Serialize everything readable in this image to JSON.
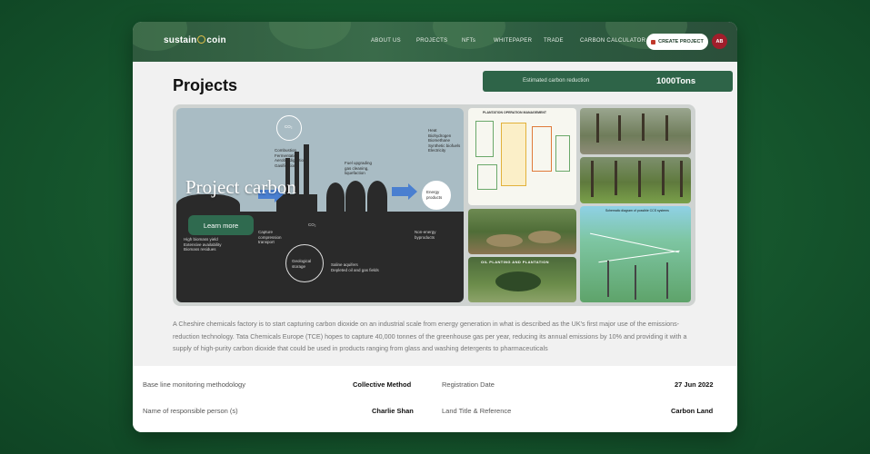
{
  "app": {
    "logo_left": "sustain",
    "logo_right": "coin"
  },
  "nav": {
    "items": [
      {
        "label": "ABOUT US"
      },
      {
        "label": "PROJECTS"
      },
      {
        "label": "NFTs"
      },
      {
        "label": "WHITEPAPER"
      },
      {
        "label": "TRADE"
      },
      {
        "label": "CARBON CALCULATOR"
      }
    ],
    "create_label": "CREATE PROJECT",
    "avatar_initials": "AB"
  },
  "page": {
    "title": "Projects"
  },
  "carbon": {
    "label": "Estimated carbon reduction",
    "value": "1000Tons"
  },
  "gallery": {
    "project_name": "Project carbon",
    "learn_more": "Learn more",
    "main_diagram": {
      "co2_top": "CO₂",
      "process": "Combustion\nFermentation\nAerobic digestion\nGasification",
      "upgrade": "Fuel upgrading\ngas cleaning,\nliquefaction",
      "products": "Heat\nBiohydrogen\nBiomethane\nSynthetic biofuels\nElectricity",
      "energy": "Energy\nproducts",
      "biomass": "High biomass yield\nExtensive availability\nBiomass residues",
      "capture": "Capture\ncompression\ntransport",
      "co2_mid": "CO₂",
      "storage": "Geological\nstorage",
      "aquifers": "Saline aquifers\nDepleted oil and gas fields",
      "nonenergy": "Non-energy\nbyproducts"
    },
    "thumbs": {
      "plantation_title": "PLANTATION OPERATION MANAGEMENT",
      "banner": "OIL PLANTING AND PLANTATION",
      "ccs_title": "Schematic diagram of possible CCS systems"
    }
  },
  "description": "A Cheshire chemicals factory is to start capturing carbon dioxide on an industrial scale from energy generation in what is described as the UK's first major use of the emissions-reduction technology. Tata Chemicals Europe (TCE) hopes to capture 40,000 tonnes of the greenhouse gas per year, reducing its annual emissions by 10% and providing it with a supply of high-purity carbon dioxide that could be used in products ranging from glass and washing detergents to pharmaceuticals",
  "details": {
    "methodology_label": "Base line monitoring methodology",
    "methodology_value": "Collective Method",
    "registration_label": "Registration Date",
    "registration_value": "27 Jun 2022",
    "person_label": "Name of responsible person (s)",
    "person_value": "Charlie Shan",
    "land_label": "Land Title & Reference",
    "land_value": "Carbon Land"
  }
}
